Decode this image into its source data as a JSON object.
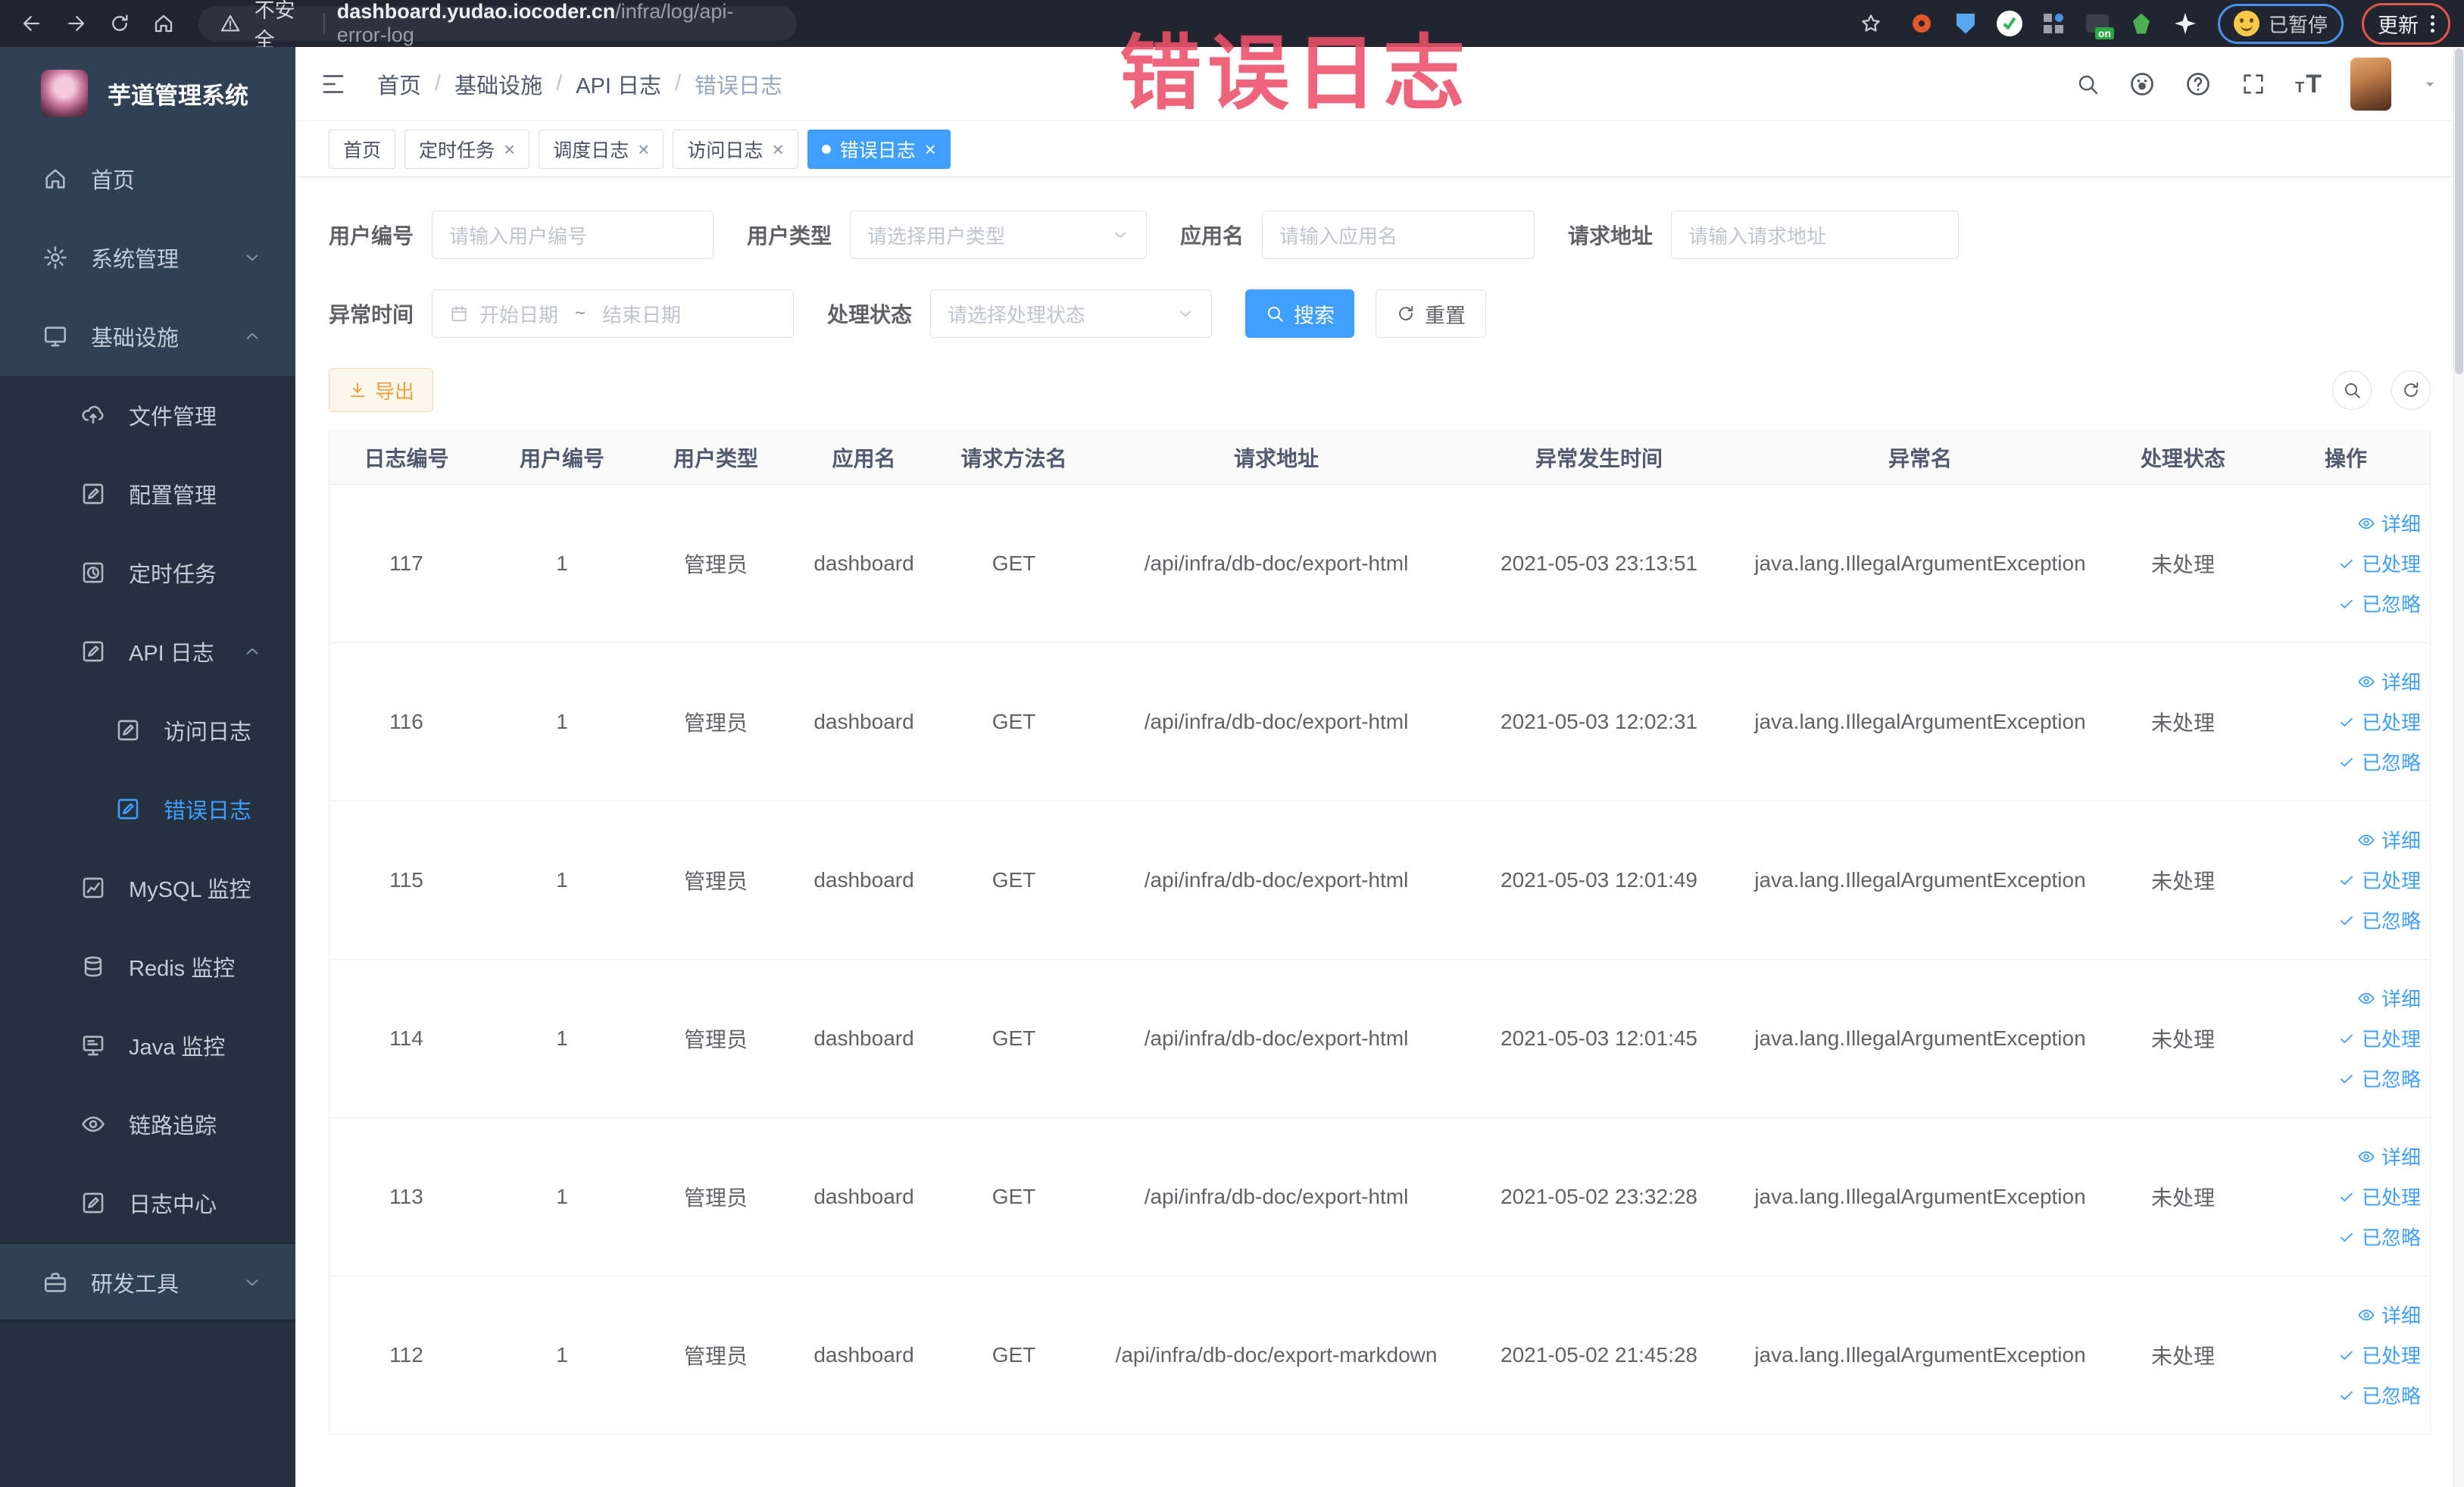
{
  "colors": {
    "accent": "#409eff",
    "warning": "#e6a23c",
    "overlay_pink": "#ee4f69",
    "sidebar_bg": "#304156",
    "sidebar_sub_bg": "#25313f"
  },
  "browser": {
    "security_label": "不安全",
    "url_domain": "dashboard.yudao.iocoder.cn",
    "url_path": "/infra/log/api-error-log",
    "paused_label": "已暂停",
    "update_label": "更新"
  },
  "sidebar": {
    "app_title": "芋道管理系统",
    "items": [
      {
        "label": "首页",
        "icon": "home",
        "level": 1
      },
      {
        "label": "系统管理",
        "icon": "gear",
        "level": 1,
        "chevron": "down"
      },
      {
        "label": "基础设施",
        "icon": "monitor",
        "level": 1,
        "chevron": "up"
      },
      {
        "label": "文件管理",
        "icon": "cloud-upload",
        "level": 2
      },
      {
        "label": "配置管理",
        "icon": "edit",
        "level": 2
      },
      {
        "label": "定时任务",
        "icon": "clock",
        "level": 2
      },
      {
        "label": "API 日志",
        "icon": "log",
        "level": 2,
        "chevron": "up"
      },
      {
        "label": "访问日志",
        "icon": "log",
        "level": 3
      },
      {
        "label": "错误日志",
        "icon": "log",
        "level": 3,
        "active": true
      },
      {
        "label": "MySQL 监控",
        "icon": "chart",
        "level": 2
      },
      {
        "label": "Redis 监控",
        "icon": "database",
        "level": 2
      },
      {
        "label": "Java 监控",
        "icon": "java",
        "level": 2
      },
      {
        "label": "链路追踪",
        "icon": "eye",
        "level": 2
      },
      {
        "label": "日志中心",
        "icon": "log",
        "level": 2
      },
      {
        "label": "研发工具",
        "icon": "toolbox",
        "level": 1,
        "chevron": "down",
        "band": true
      }
    ]
  },
  "topbar": {
    "breadcrumb": [
      "首页",
      "基础设施",
      "API 日志",
      "错误日志"
    ]
  },
  "tabs": [
    {
      "label": "首页"
    },
    {
      "label": "定时任务",
      "closable": true
    },
    {
      "label": "调度日志",
      "closable": true
    },
    {
      "label": "访问日志",
      "closable": true
    },
    {
      "label": "错误日志",
      "closable": true,
      "active": true
    }
  ],
  "overlay_title": "错误日志",
  "filters": {
    "user_id": {
      "label": "用户编号",
      "placeholder": "请输入用户编号"
    },
    "user_type": {
      "label": "用户类型",
      "placeholder": "请选择用户类型"
    },
    "app_name": {
      "label": "应用名",
      "placeholder": "请输入应用名"
    },
    "request_url": {
      "label": "请求地址",
      "placeholder": "请输入请求地址"
    },
    "exception_time": {
      "label": "异常时间",
      "start_placeholder": "开始日期",
      "separator": "~",
      "end_placeholder": "结束日期"
    },
    "process_status": {
      "label": "处理状态",
      "placeholder": "请选择处理状态"
    },
    "search_label": "搜索",
    "reset_label": "重置"
  },
  "toolbar": {
    "export_label": "导出"
  },
  "table": {
    "columns": [
      "日志编号",
      "用户编号",
      "用户类型",
      "应用名",
      "请求方法名",
      "请求地址",
      "异常发生时间",
      "异常名",
      "处理状态",
      "操作"
    ],
    "row_actions": [
      "详细",
      "已处理",
      "已忽略"
    ],
    "rows": [
      {
        "id": "117",
        "user_id": "1",
        "user_type": "管理员",
        "app": "dashboard",
        "method": "GET",
        "url": "/api/infra/db-doc/export-html",
        "time": "2021-05-03 23:13:51",
        "exception": "java.lang.IllegalArgumentException",
        "status": "未处理"
      },
      {
        "id": "116",
        "user_id": "1",
        "user_type": "管理员",
        "app": "dashboard",
        "method": "GET",
        "url": "/api/infra/db-doc/export-html",
        "time": "2021-05-03 12:02:31",
        "exception": "java.lang.IllegalArgumentException",
        "status": "未处理"
      },
      {
        "id": "115",
        "user_id": "1",
        "user_type": "管理员",
        "app": "dashboard",
        "method": "GET",
        "url": "/api/infra/db-doc/export-html",
        "time": "2021-05-03 12:01:49",
        "exception": "java.lang.IllegalArgumentException",
        "status": "未处理"
      },
      {
        "id": "114",
        "user_id": "1",
        "user_type": "管理员",
        "app": "dashboard",
        "method": "GET",
        "url": "/api/infra/db-doc/export-html",
        "time": "2021-05-03 12:01:45",
        "exception": "java.lang.IllegalArgumentException",
        "status": "未处理"
      },
      {
        "id": "113",
        "user_id": "1",
        "user_type": "管理员",
        "app": "dashboard",
        "method": "GET",
        "url": "/api/infra/db-doc/export-html",
        "time": "2021-05-02 23:32:28",
        "exception": "java.lang.IllegalArgumentException",
        "status": "未处理"
      },
      {
        "id": "112",
        "user_id": "1",
        "user_type": "管理员",
        "app": "dashboard",
        "method": "GET",
        "url": "/api/infra/db-doc/export-markdown",
        "time": "2021-05-02 21:45:28",
        "exception": "java.lang.IllegalArgumentException",
        "status": "未处理"
      }
    ]
  }
}
